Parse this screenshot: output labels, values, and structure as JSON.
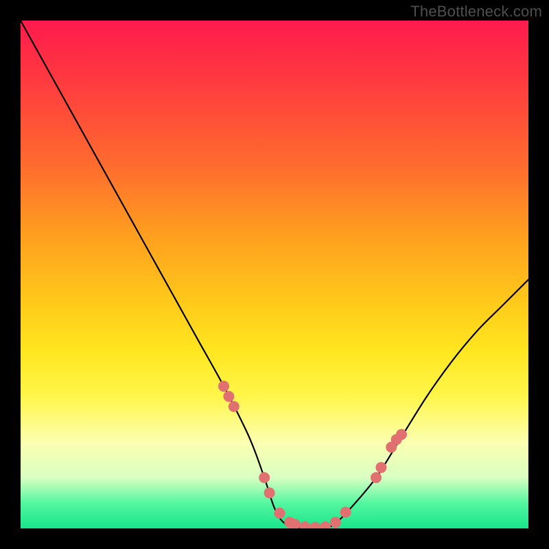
{
  "watermark": "TheBottleneck.com",
  "chart_data": {
    "type": "line",
    "title": "",
    "xlabel": "",
    "ylabel": "",
    "xlim": [
      0,
      100
    ],
    "ylim": [
      0,
      100
    ],
    "grid": false,
    "legend": false,
    "background_gradient": {
      "top": "#ff1a4d",
      "mid": "#ffe61f",
      "bottom": "#18e58a"
    },
    "series": [
      {
        "name": "bottleneck-curve",
        "x": [
          0,
          5,
          10,
          15,
          20,
          25,
          30,
          35,
          40,
          45,
          48,
          50,
          52,
          55,
          58,
          60,
          62,
          65,
          70,
          75,
          80,
          85,
          90,
          95,
          100
        ],
        "y": [
          100,
          91,
          82,
          73,
          64,
          55,
          46,
          37,
          28,
          18,
          10,
          4,
          1,
          0,
          0,
          0,
          1,
          4,
          10,
          18,
          26,
          33,
          39,
          44,
          49
        ],
        "color": "#000000"
      }
    ],
    "markers": {
      "name": "highlighted-points",
      "color": "#e17070",
      "radius_px": 8,
      "points_xy": [
        [
          40,
          28
        ],
        [
          41,
          26
        ],
        [
          42,
          24
        ],
        [
          48,
          10
        ],
        [
          49,
          7
        ],
        [
          51,
          3
        ],
        [
          53,
          1.2
        ],
        [
          54,
          0.8
        ],
        [
          56,
          0.3
        ],
        [
          58,
          0.2
        ],
        [
          60,
          0.3
        ],
        [
          62,
          1.2
        ],
        [
          64,
          3.2
        ],
        [
          70,
          10
        ],
        [
          71,
          12
        ],
        [
          73,
          16
        ],
        [
          74,
          17.5
        ],
        [
          75,
          18.5
        ]
      ]
    }
  }
}
